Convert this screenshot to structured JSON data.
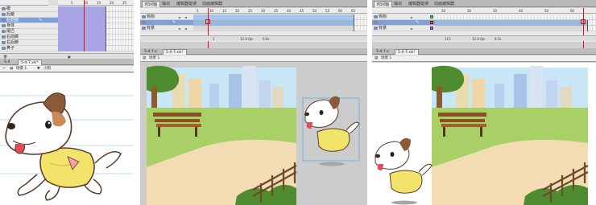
{
  "colors": {
    "playhead": "#e01010",
    "tween_purple": "#a9a5e6",
    "tween_blue": "#a8c6ea",
    "selected_row": "#7f9fd6",
    "stage_gray": "#cccccc"
  },
  "panel1": {
    "layers": [
      "眼",
      "后腿",
      "右前腿",
      "身体",
      "尾巴",
      "右前脚",
      "右后脚",
      "鼻子"
    ],
    "ruler": [
      "5",
      "10",
      "15",
      "20",
      "25"
    ],
    "doc_tab": "5-4-7.xls*",
    "scene": "场景 1",
    "edit_symbol": "小狗"
  },
  "panel2": {
    "tabs": [
      "时间轴",
      "输出",
      "编辑器错误",
      "动画编辑器"
    ],
    "layers": [
      "狗狗",
      "背景"
    ],
    "ruler": [
      "5",
      "10",
      "15",
      "20",
      "25",
      "30",
      "35",
      "40",
      "45",
      "50",
      "55",
      "60",
      "65",
      "70",
      "75",
      "80",
      "85",
      "90",
      "95",
      "100",
      "105",
      "110",
      "115",
      "120",
      "125"
    ],
    "status": [
      "1",
      "12.0 fps",
      "0.0s"
    ],
    "doc_tabs": [
      "5-4-7.s",
      "5-4-7.xls*"
    ],
    "scene": "场景 1"
  },
  "panel3": {
    "tabs": [
      "时间轴",
      "输出",
      "编辑器错误",
      "动画编辑器"
    ],
    "layers": [
      "狗狗",
      "背景"
    ],
    "ruler": [
      "5",
      "10",
      "15",
      "20",
      "25",
      "30",
      "35",
      "40",
      "45",
      "50",
      "55",
      "60",
      "65",
      "70",
      "75",
      "80",
      "85",
      "90",
      "95",
      "100",
      "105",
      "110",
      "115",
      "120"
    ],
    "status": [
      "115",
      "12.0 fps",
      "9.5s"
    ],
    "doc_tabs": [
      "5-4-7.s",
      "5-4-7.xls*"
    ],
    "scene": "场景 1"
  }
}
